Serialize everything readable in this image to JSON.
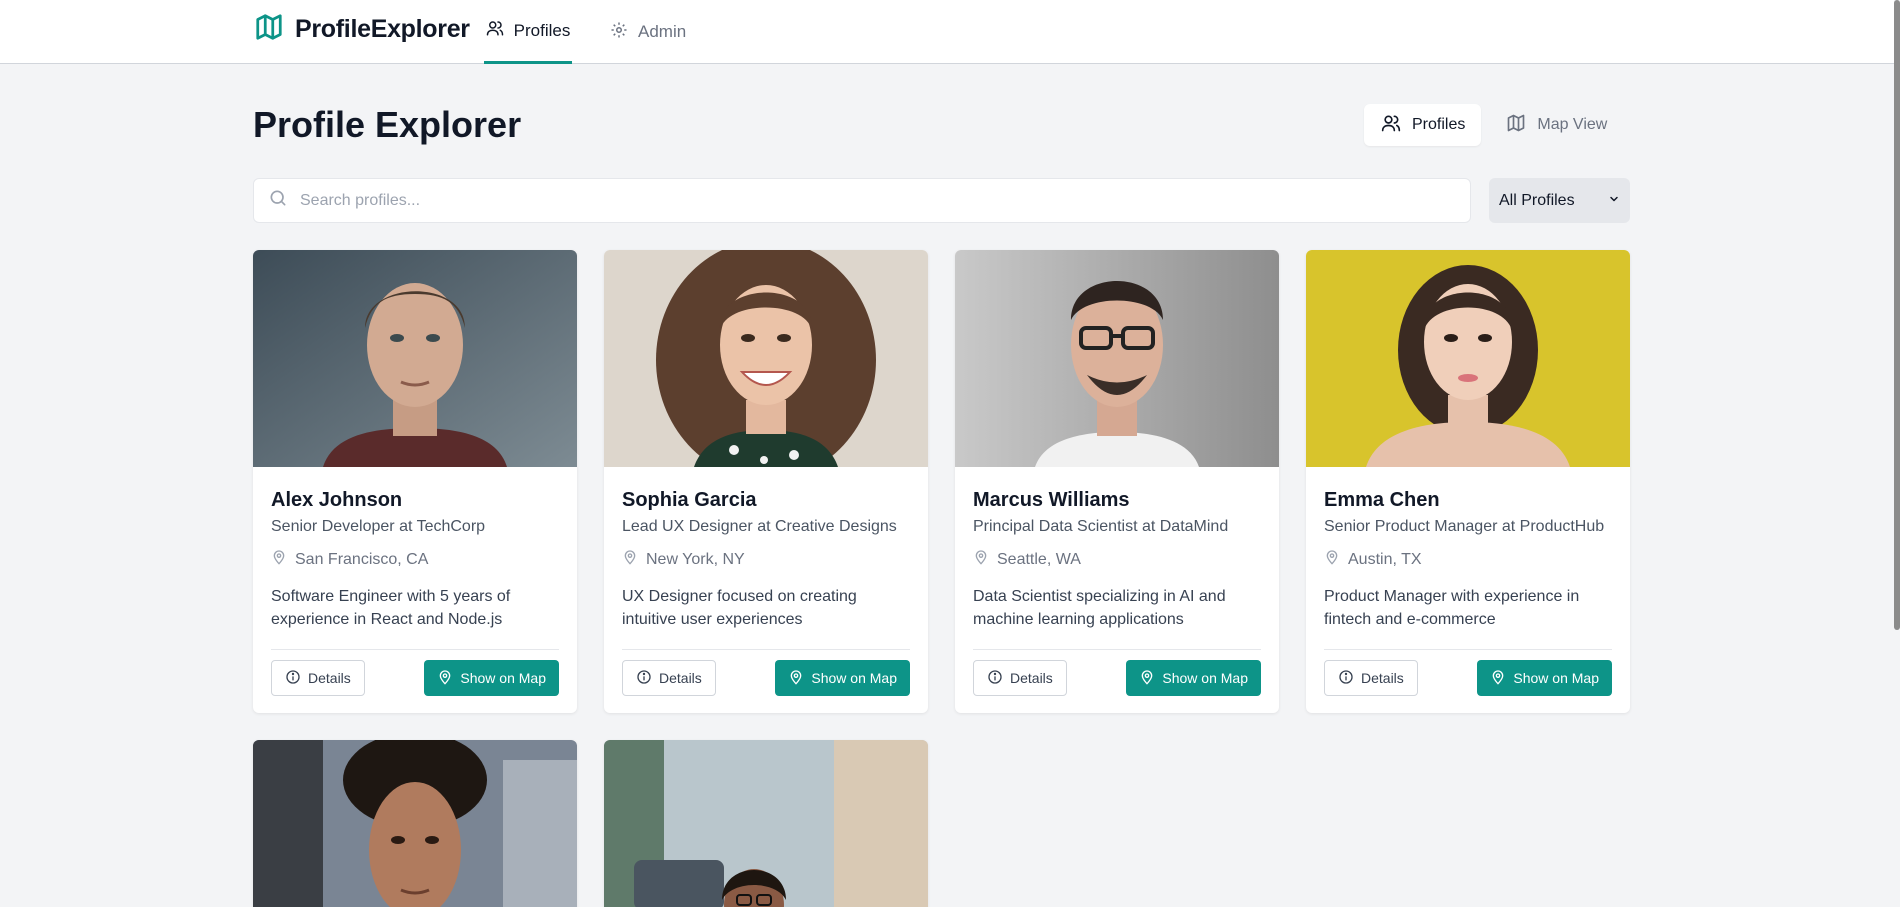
{
  "app": {
    "brand": "ProfileExplorer",
    "nav": [
      {
        "label": "Profiles",
        "icon": "users-icon",
        "active": true
      },
      {
        "label": "Admin",
        "icon": "gear-icon",
        "active": false
      }
    ]
  },
  "page": {
    "title": "Profile Explorer",
    "view_toggle": [
      {
        "label": "Profiles",
        "icon": "users-icon",
        "active": true
      },
      {
        "label": "Map View",
        "icon": "map-icon",
        "active": false
      }
    ],
    "search": {
      "placeholder": "Search profiles...",
      "value": ""
    },
    "filter": {
      "selected": "All Profiles"
    }
  },
  "buttons": {
    "details": "Details",
    "show_on_map": "Show on Map"
  },
  "profiles": [
    {
      "name": "Alex Johnson",
      "title": "Senior Developer at TechCorp",
      "location": "San Francisco, CA",
      "bio": "Software Engineer with 5 years of experience in React and Node.js"
    },
    {
      "name": "Sophia Garcia",
      "title": "Lead UX Designer at Creative Designs",
      "location": "New York, NY",
      "bio": "UX Designer focused on creating intuitive user experiences"
    },
    {
      "name": "Marcus Williams",
      "title": "Principal Data Scientist at DataMind",
      "location": "Seattle, WA",
      "bio": "Data Scientist specializing in AI and machine learning applications"
    },
    {
      "name": "Emma Chen",
      "title": "Senior Product Manager at ProductHub",
      "location": "Austin, TX",
      "bio": "Product Manager with experience in fintech and e-commerce"
    }
  ],
  "colors": {
    "accent": "#0d9488",
    "background": "#f3f4f6",
    "text": "#111827",
    "muted": "#6b7280"
  }
}
